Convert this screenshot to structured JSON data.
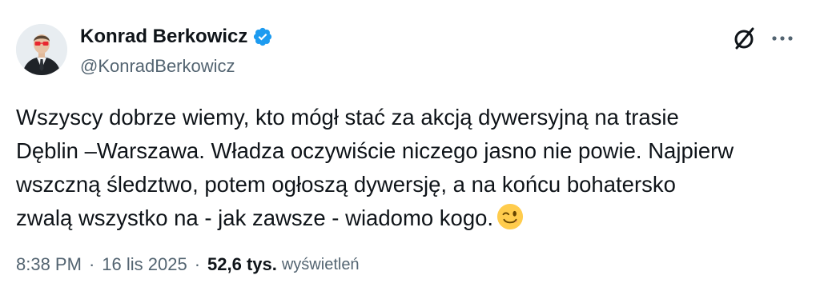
{
  "author": {
    "display_name": "Konrad Berkowicz",
    "handle": "@KonradBerkowicz",
    "avatar_icon": "avatar-photo",
    "verified_icon": "verified-badge-icon",
    "verified_color": "#1d9bf0"
  },
  "header_actions": {
    "grok_icon": "grok-icon",
    "more_icon": "more-horizontal-icon"
  },
  "tweet": {
    "lines": [
      "Wszyscy dobrze wiemy, kto mógł stać za akcją dywersyjną na trasie",
      "Dęblin –Warszawa. Władza oczywiście niczego jasno nie powie. Najpierw",
      "wszczną śledztwo, potem ogłoszą dywersję, a na końcu bohatersko",
      "zwalą wszystko na - jak zawsze - wiadomo kogo."
    ],
    "emoji": "winking-face-emoji"
  },
  "meta": {
    "time": "8:38 PM",
    "separator": "·",
    "date": "16 lis 2025",
    "views_count": "52,6 tys.",
    "views_label": "wyświetleń"
  },
  "colors": {
    "text_primary": "#0f1419",
    "text_secondary": "#536471",
    "accent": "#1d9bf0",
    "background": "#ffffff"
  }
}
